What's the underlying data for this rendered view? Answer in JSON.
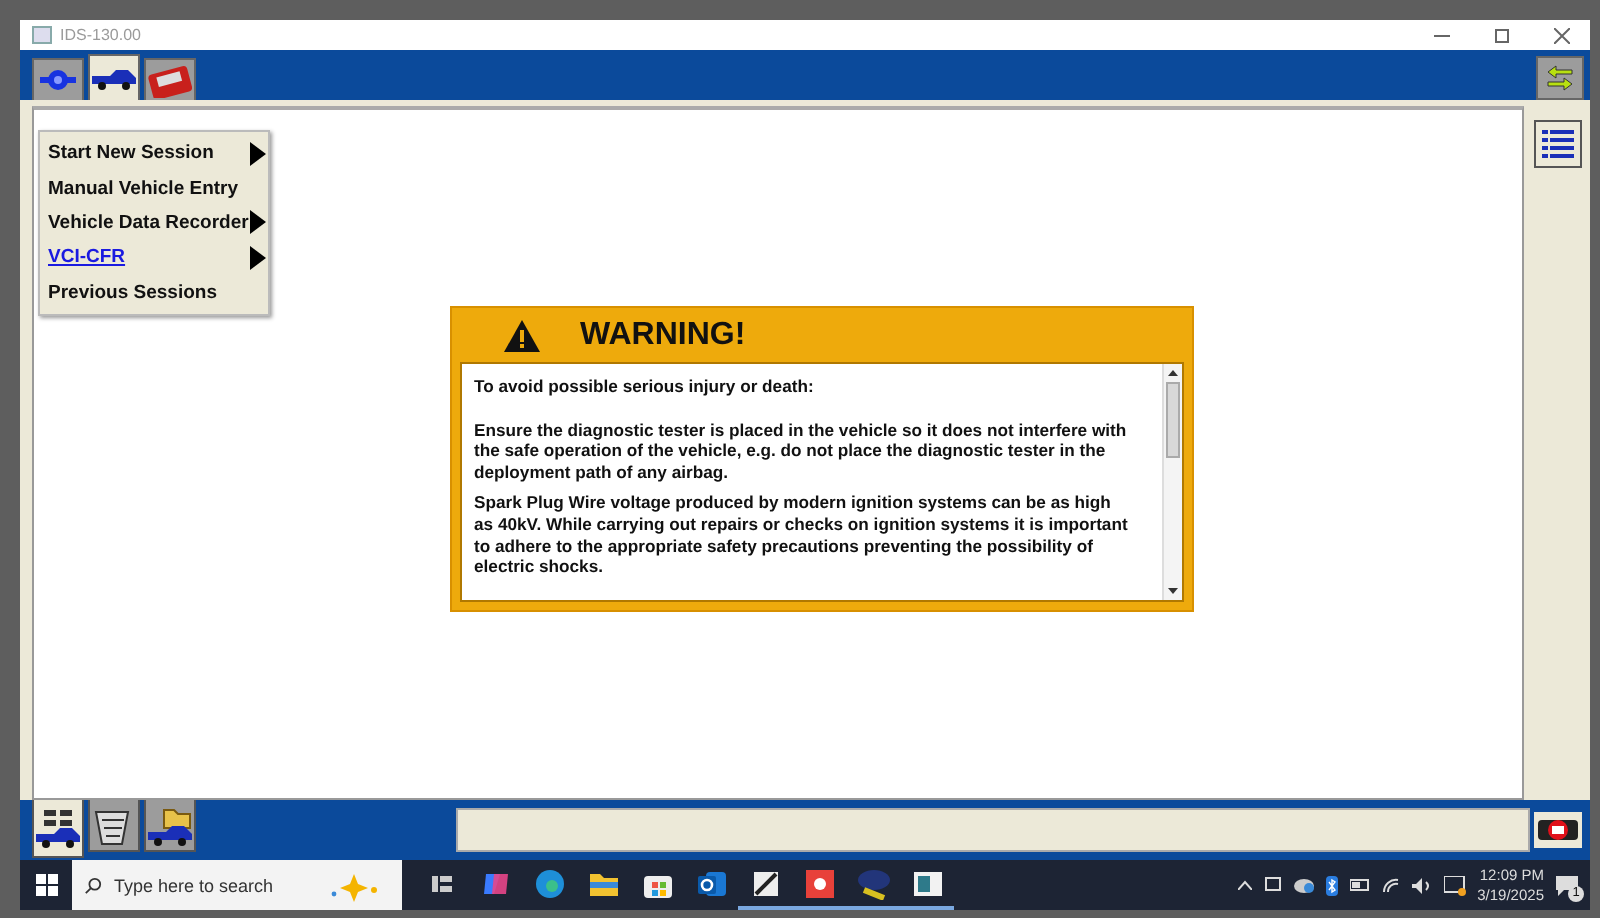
{
  "window": {
    "title": "IDS-130.00"
  },
  "top_tabs": [
    {
      "kind": "connector",
      "selected": false
    },
    {
      "kind": "vehicle",
      "selected": true
    },
    {
      "kind": "toolbox",
      "selected": false
    }
  ],
  "menu": {
    "items": [
      {
        "label": "Start New Session",
        "submenu": true,
        "link": false
      },
      {
        "label": "Manual Vehicle Entry",
        "submenu": false,
        "link": false
      },
      {
        "label": "Vehicle Data Recorder",
        "submenu": true,
        "link": false
      },
      {
        "label": "VCI-CFR",
        "submenu": true,
        "link": true
      },
      {
        "label": "Previous Sessions",
        "submenu": false,
        "link": false
      }
    ]
  },
  "warning": {
    "title": "WARNING!",
    "paragraphs": [
      "To avoid possible serious injury or death:",
      "Ensure the diagnostic tester is placed in the vehicle so it does not interfere with the safe operation of the vehicle, e.g. do not place the diagnostic tester in the deployment path of any airbag.",
      "Spark Plug Wire voltage produced by modern ignition systems can be as high as 40kV. While carrying out repairs or checks on ignition systems it is important to adhere to the appropriate safety precautions preventing the possibility of electric shocks."
    ]
  },
  "bottom_tabs": [
    {
      "kind": "vehicle-info",
      "selected": true
    },
    {
      "kind": "datalogger",
      "selected": false
    },
    {
      "kind": "vehicle-folder",
      "selected": false
    }
  ],
  "taskbar": {
    "search": {
      "placeholder": "Type here to search"
    },
    "apps": [
      {
        "kind": "taskview",
        "running": false
      },
      {
        "kind": "copilot",
        "running": false
      },
      {
        "kind": "edge",
        "running": false
      },
      {
        "kind": "folder",
        "running": false
      },
      {
        "kind": "store",
        "running": false
      },
      {
        "kind": "mail",
        "running": false
      },
      {
        "kind": "editor",
        "running": true
      },
      {
        "kind": "remote",
        "running": true
      },
      {
        "kind": "ids",
        "running": true
      },
      {
        "kind": "window",
        "running": true
      }
    ],
    "time": "12:09 PM",
    "date": "3/19/2025",
    "notifications": "1"
  }
}
